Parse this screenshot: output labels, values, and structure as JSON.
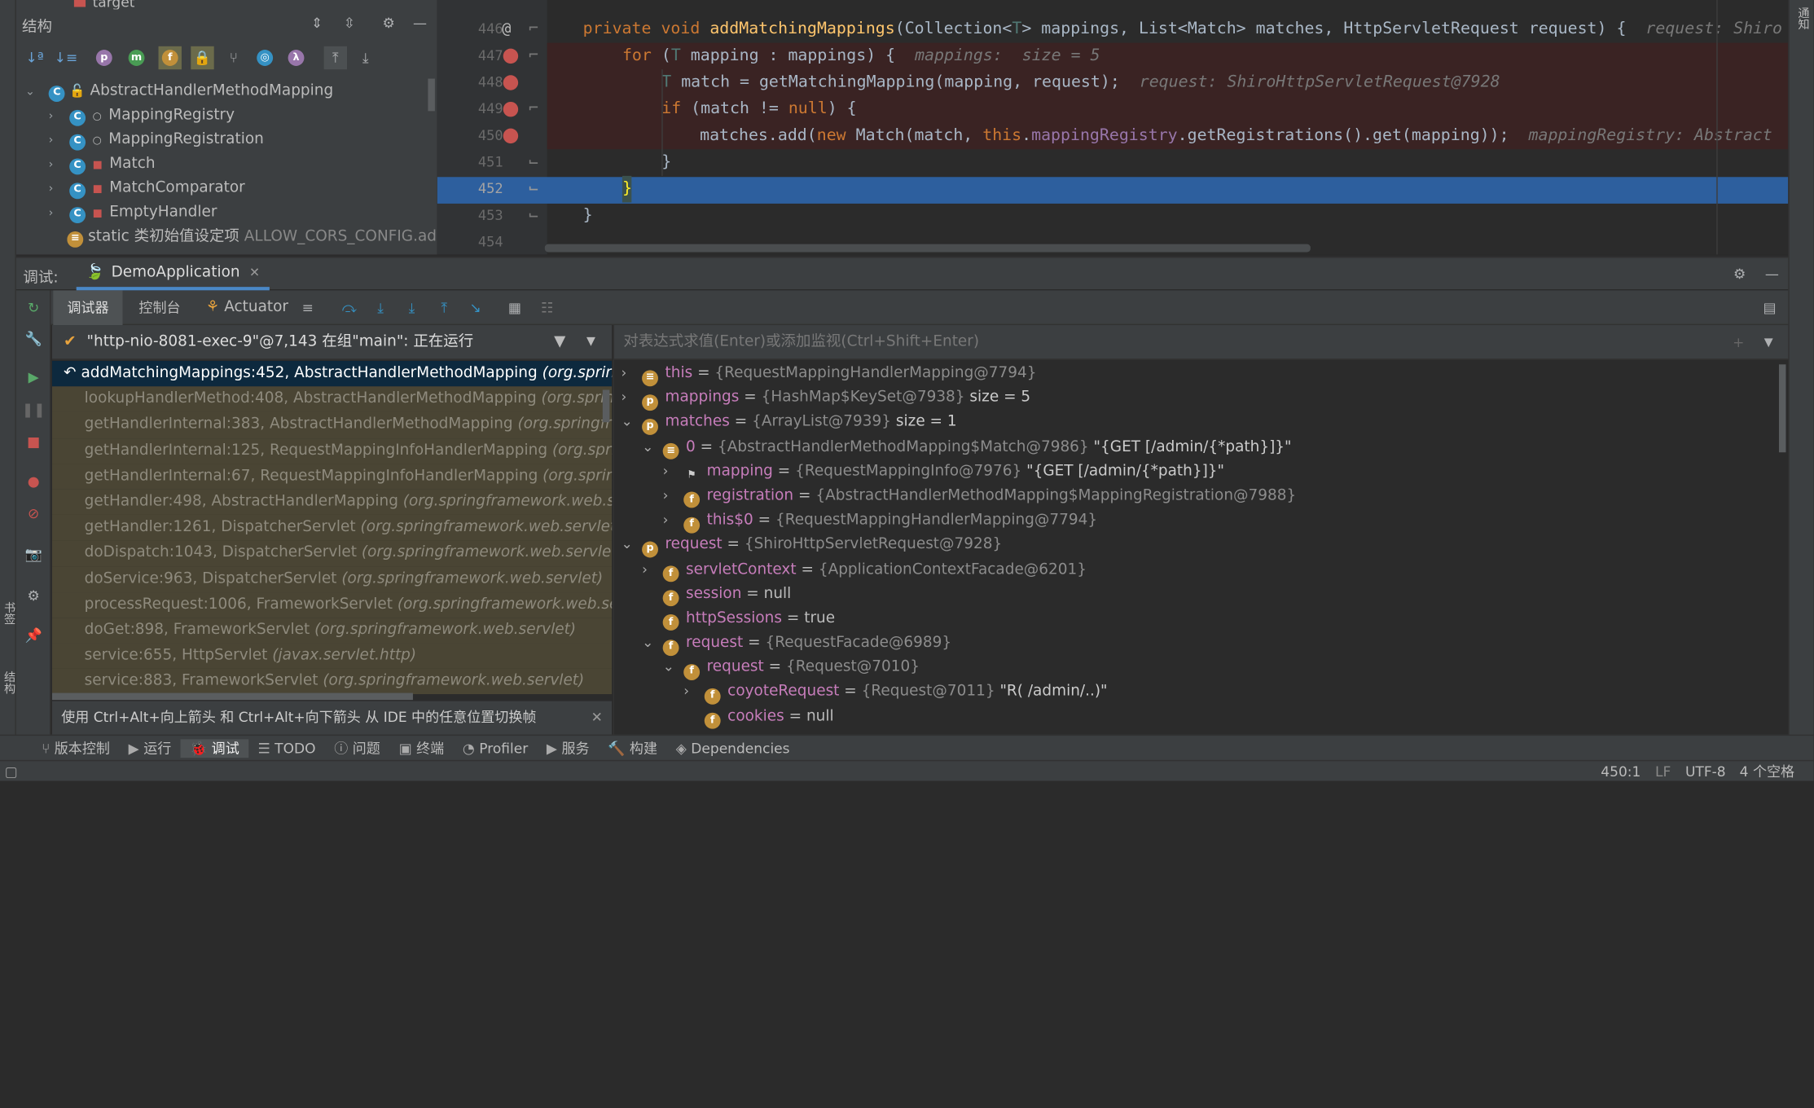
{
  "structure": {
    "title": "结构",
    "root": "AbstractHandlerMethodMapping",
    "items": [
      "MappingRegistry",
      "MappingRegistration",
      "Match",
      "MatchComparator",
      "EmptyHandler"
    ],
    "static_init": "static 类初始值设定项",
    "static_init_value": "ALLOW_CORS_CONFIG.ad...",
    "top_item": "target"
  },
  "editor": {
    "lines": [
      "446",
      "447",
      "448",
      "449",
      "450",
      "451",
      "452",
      "453",
      "454"
    ],
    "c446a": "private",
    "c446b": "void",
    "c446c": "addMatchingMappings",
    "c446d": "(Collection<",
    "c446e": "T",
    "c446f": "> mappings, List<Match> matches, HttpServletRequest request) {",
    "c446g": "request: Shiro",
    "c447a": "for",
    "c447b": " (",
    "c447c": "T",
    "c447d": " mapping : mappings) {",
    "c447e": "mappings:  size = 5",
    "c448a": "T",
    "c448b": " match = getMatchingMapping(mapping, request);",
    "c448c": "request: ShiroHttpServletRequest@7928",
    "c449a": "if",
    "c449b": " (match != ",
    "c449c": "null",
    "c449d": ") {",
    "c450a": "matches.add(",
    "c450b": "new",
    "c450c": " Match(match, ",
    "c450d": "this",
    "c450e": ".",
    "c450f": "mappingRegistry",
    "c450g": ".getRegistrations().get(mapping));",
    "c450h": "mappingRegistry: Abstract",
    "c451": "}",
    "c452": "}",
    "c453": "}",
    "side_tab": "通知"
  },
  "debug": {
    "label": "调试:",
    "session": "DemoApplication",
    "tabs": [
      "调试器",
      "控制台",
      "Actuator"
    ],
    "thread": "\"http-nio-8081-exec-9\"@7,143 在组\"main\": 正在运行",
    "frames": [
      {
        "m": "addMatchingMappings:452, AbstractHandlerMethodMapping",
        "p": "(org.springfr"
      },
      {
        "m": "lookupHandlerMethod:408, AbstractHandlerMethodMapping",
        "p": "(org.springfra"
      },
      {
        "m": "getHandlerInternal:383, AbstractHandlerMethodMapping",
        "p": "(org.springfra"
      },
      {
        "m": "getHandlerInternal:125, RequestMappingInfoHandlerMapping",
        "p": "(org.springf"
      },
      {
        "m": "getHandlerInternal:67, RequestMappingInfoHandlerMapping",
        "p": "(org.springfra"
      },
      {
        "m": "getHandler:498, AbstractHandlerMapping",
        "p": "(org.springframework.web.servle"
      },
      {
        "m": "getHandler:1261, DispatcherServlet",
        "p": "(org.springframework.web.servlet)"
      },
      {
        "m": "doDispatch:1043, DispatcherServlet",
        "p": "(org.springframework.web.servlet)"
      },
      {
        "m": "doService:963, DispatcherServlet",
        "p": "(org.springframework.web.servlet)"
      },
      {
        "m": "processRequest:1006, FrameworkServlet",
        "p": "(org.springframework.web.servlet)"
      },
      {
        "m": "doGet:898, FrameworkServlet",
        "p": "(org.springframework.web.servlet)"
      },
      {
        "m": "service:655, HttpServlet",
        "p": "(javax.servlet.http)"
      },
      {
        "m": "service:883, FrameworkServlet",
        "p": "(org.springframework.web.servlet)"
      }
    ],
    "hint": "使用 Ctrl+Alt+向上箭头 和 Ctrl+Alt+向下箭头 从 IDE 中的任意位置切换帧",
    "eval_placeholder": "对表达式求值(Enter)或添加监视(Ctrl+Shift+Enter)",
    "vars": [
      {
        "n": "this",
        "v": "{RequestMappingHandlerMapping@7794}",
        "x": ""
      },
      {
        "n": "mappings",
        "v": "{HashMap$KeySet@7938}",
        "x": " size = 5"
      },
      {
        "n": "matches",
        "v": "{ArrayList@7939}",
        "x": " size = 1"
      },
      {
        "n": "0",
        "v": "{AbstractHandlerMethodMapping$Match@7986}",
        "x": " \"{GET [/admin/{*path}]}\""
      },
      {
        "n": "mapping",
        "v": "{RequestMappingInfo@7976}",
        "x": " \"{GET [/admin/{*path}]}\""
      },
      {
        "n": "registration",
        "v": "{AbstractHandlerMethodMapping$MappingRegistration@7988}",
        "x": ""
      },
      {
        "n": "this$0",
        "v": "{RequestMappingHandlerMapping@7794}",
        "x": ""
      },
      {
        "n": "request",
        "v": "{ShiroHttpServletRequest@7928}",
        "x": ""
      },
      {
        "n": "servletContext",
        "v": "{ApplicationContextFacade@6201}",
        "x": ""
      },
      {
        "n": "session",
        "v": "null",
        "x": ""
      },
      {
        "n": "httpSessions",
        "v": "true",
        "x": ""
      },
      {
        "n": "request",
        "v": "{RequestFacade@6989}",
        "x": ""
      },
      {
        "n": "request",
        "v": "{Request@7010}",
        "x": ""
      },
      {
        "n": "coyoteRequest",
        "v": "{Request@7011}",
        "x": " \"R( /admin/..)\""
      },
      {
        "n": "cookies",
        "v": "null",
        "x": ""
      }
    ]
  },
  "bottom": {
    "items": [
      "版本控制",
      "运行",
      "调试",
      "TODO",
      "问题",
      "终端",
      "Profiler",
      "服务",
      "构建",
      "Dependencies"
    ],
    "left_tabs": [
      "书签",
      "结构"
    ]
  },
  "status": {
    "pos": "450:1",
    "lf": "LF",
    "enc": "UTF-8",
    "indent": "4 个空格"
  }
}
